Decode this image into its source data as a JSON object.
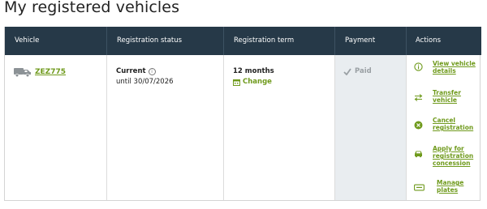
{
  "page": {
    "title": "My registered vehicles"
  },
  "table": {
    "headers": {
      "vehicle": "Vehicle",
      "status": "Registration status",
      "term": "Registration term",
      "payment": "Payment",
      "actions": "Actions"
    },
    "row": {
      "rego": "ZEZ775",
      "status": "Current",
      "status_until": "until 30/07/2026",
      "term": "12 months",
      "change": "Change",
      "payment": "Paid"
    },
    "actions": [
      {
        "line1": "View vehicle",
        "line2": "details",
        "icon": "info-circle-icon"
      },
      {
        "line1": "Transfer",
        "line2": "vehicle",
        "icon": "transfer-arrows-icon"
      },
      {
        "line1": "Cancel",
        "line2": "registration",
        "icon": "cancel-circle-icon"
      },
      {
        "line1": "Apply for",
        "line2": "registration",
        "line3": "concession",
        "icon": "car-icon"
      },
      {
        "line1": "Manage",
        "line2": "plates",
        "icon": "plate-icon"
      }
    ]
  },
  "colors": {
    "header_bg": "#263948",
    "accent_green": "#6f9a1c",
    "payment_bg": "#e9edf0",
    "paid_grey": "#9aa0a4"
  }
}
